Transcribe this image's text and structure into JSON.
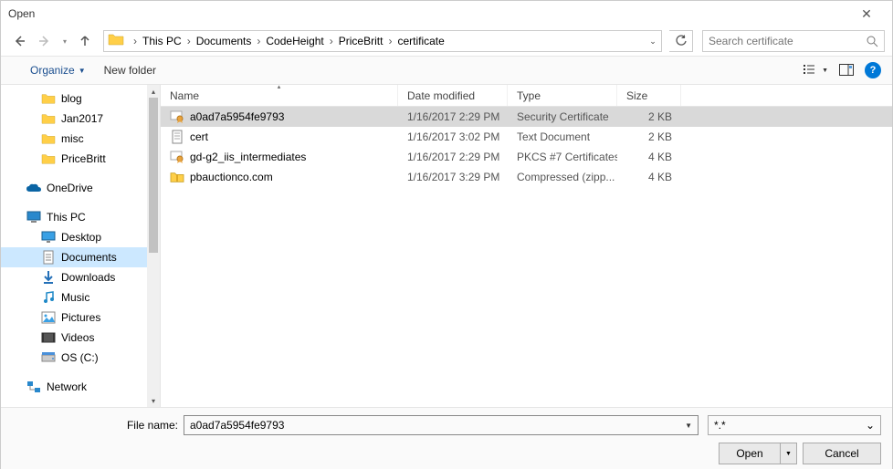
{
  "window": {
    "title": "Open"
  },
  "breadcrumbs": [
    "This PC",
    "Documents",
    "CodeHeight",
    "PriceBritt",
    "certificate"
  ],
  "search": {
    "placeholder": "Search certificate"
  },
  "toolbar": {
    "organize": "Organize",
    "newfolder": "New folder"
  },
  "tree": {
    "folders": [
      {
        "label": "blog",
        "type": "folder",
        "lvl": 2
      },
      {
        "label": "Jan2017",
        "type": "folder",
        "lvl": 2
      },
      {
        "label": "misc",
        "type": "folder",
        "lvl": 2
      },
      {
        "label": "PriceBritt",
        "type": "folder",
        "lvl": 2
      }
    ],
    "onedrive": "OneDrive",
    "thispc": "This PC",
    "pcitems": [
      {
        "label": "Desktop",
        "icon": "desktop"
      },
      {
        "label": "Documents",
        "icon": "doc",
        "selected": true
      },
      {
        "label": "Downloads",
        "icon": "download"
      },
      {
        "label": "Music",
        "icon": "music"
      },
      {
        "label": "Pictures",
        "icon": "pictures"
      },
      {
        "label": "Videos",
        "icon": "videos"
      },
      {
        "label": "OS (C:)",
        "icon": "drive"
      }
    ],
    "network": "Network"
  },
  "columns": {
    "name": "Name",
    "date": "Date modified",
    "type": "Type",
    "size": "Size"
  },
  "files": [
    {
      "name": "a0ad7a5954fe9793",
      "date": "1/16/2017 2:29 PM",
      "type": "Security Certificate",
      "size": "2 KB",
      "icon": "cert",
      "selected": true
    },
    {
      "name": "cert",
      "date": "1/16/2017 3:02 PM",
      "type": "Text Document",
      "size": "2 KB",
      "icon": "txt"
    },
    {
      "name": "gd-g2_iis_intermediates",
      "date": "1/16/2017 2:29 PM",
      "type": "PKCS #7 Certificates",
      "size": "4 KB",
      "icon": "cert"
    },
    {
      "name": "pbauctionco.com",
      "date": "1/16/2017 3:29 PM",
      "type": "Compressed (zipp...",
      "size": "4 KB",
      "icon": "zip"
    }
  ],
  "footer": {
    "fnlabel": "File name:",
    "fnvalue": "a0ad7a5954fe9793",
    "filter": "*.*",
    "open": "Open",
    "cancel": "Cancel"
  }
}
